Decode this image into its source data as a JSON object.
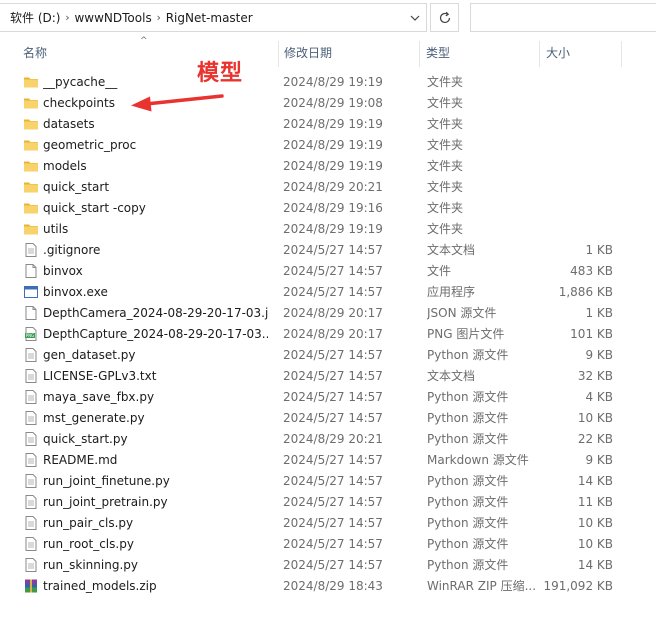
{
  "address": {
    "crumbs": [
      "软件 (D:)",
      "wwwNDTools",
      "RigNet-master"
    ]
  },
  "columns": {
    "name": "名称",
    "date": "修改日期",
    "type": "类型",
    "size": "大小"
  },
  "annotation": {
    "label": "模型",
    "color": "#e8332f"
  },
  "files": [
    {
      "name": "__pycache__",
      "date": "2024/8/29 19:19",
      "type": "文件夹",
      "size": "",
      "icon": "folder-icon"
    },
    {
      "name": "checkpoints",
      "date": "2024/8/29 19:08",
      "type": "文件夹",
      "size": "",
      "icon": "folder-icon"
    },
    {
      "name": "datasets",
      "date": "2024/8/29 19:19",
      "type": "文件夹",
      "size": "",
      "icon": "folder-icon"
    },
    {
      "name": "geometric_proc",
      "date": "2024/8/29 19:19",
      "type": "文件夹",
      "size": "",
      "icon": "folder-icon"
    },
    {
      "name": "models",
      "date": "2024/8/29 19:19",
      "type": "文件夹",
      "size": "",
      "icon": "folder-icon"
    },
    {
      "name": "quick_start",
      "date": "2024/8/29 20:21",
      "type": "文件夹",
      "size": "",
      "icon": "folder-icon"
    },
    {
      "name": "quick_start -copy",
      "date": "2024/8/29 19:16",
      "type": "文件夹",
      "size": "",
      "icon": "folder-icon"
    },
    {
      "name": "utils",
      "date": "2024/8/29 19:19",
      "type": "文件夹",
      "size": "",
      "icon": "folder-icon"
    },
    {
      "name": ".gitignore",
      "date": "2024/5/27 14:57",
      "type": "文本文档",
      "size": "1 KB",
      "icon": "text-file-icon"
    },
    {
      "name": "binvox",
      "date": "2024/5/27 14:57",
      "type": "文件",
      "size": "483 KB",
      "icon": "blank-file-icon"
    },
    {
      "name": "binvox.exe",
      "date": "2024/5/27 14:57",
      "type": "应用程序",
      "size": "1,886 KB",
      "icon": "exe-icon"
    },
    {
      "name": "DepthCamera_2024-08-29-20-17-03.j...",
      "date": "2024/8/29 20:17",
      "type": "JSON 源文件",
      "size": "1 KB",
      "icon": "blank-file-icon"
    },
    {
      "name": "DepthCapture_2024-08-29-20-17-03....",
      "date": "2024/8/29 20:17",
      "type": "PNG 图片文件",
      "size": "101 KB",
      "icon": "png-icon"
    },
    {
      "name": "gen_dataset.py",
      "date": "2024/5/27 14:57",
      "type": "Python 源文件",
      "size": "9 KB",
      "icon": "text-file-icon"
    },
    {
      "name": "LICENSE-GPLv3.txt",
      "date": "2024/5/27 14:57",
      "type": "文本文档",
      "size": "32 KB",
      "icon": "text-file-icon"
    },
    {
      "name": "maya_save_fbx.py",
      "date": "2024/5/27 14:57",
      "type": "Python 源文件",
      "size": "4 KB",
      "icon": "text-file-icon"
    },
    {
      "name": "mst_generate.py",
      "date": "2024/5/27 14:57",
      "type": "Python 源文件",
      "size": "10 KB",
      "icon": "text-file-icon"
    },
    {
      "name": "quick_start.py",
      "date": "2024/8/29 20:21",
      "type": "Python 源文件",
      "size": "22 KB",
      "icon": "text-file-icon"
    },
    {
      "name": "README.md",
      "date": "2024/5/27 14:57",
      "type": "Markdown 源文件",
      "size": "9 KB",
      "icon": "text-file-icon"
    },
    {
      "name": "run_joint_finetune.py",
      "date": "2024/5/27 14:57",
      "type": "Python 源文件",
      "size": "14 KB",
      "icon": "text-file-icon"
    },
    {
      "name": "run_joint_pretrain.py",
      "date": "2024/5/27 14:57",
      "type": "Python 源文件",
      "size": "11 KB",
      "icon": "text-file-icon"
    },
    {
      "name": "run_pair_cls.py",
      "date": "2024/5/27 14:57",
      "type": "Python 源文件",
      "size": "10 KB",
      "icon": "text-file-icon"
    },
    {
      "name": "run_root_cls.py",
      "date": "2024/5/27 14:57",
      "type": "Python 源文件",
      "size": "10 KB",
      "icon": "text-file-icon"
    },
    {
      "name": "run_skinning.py",
      "date": "2024/5/27 14:57",
      "type": "Python 源文件",
      "size": "14 KB",
      "icon": "text-file-icon"
    },
    {
      "name": "trained_models.zip",
      "date": "2024/8/29 18:43",
      "type": "WinRAR ZIP 压缩...",
      "size": "191,092 KB",
      "icon": "winrar-icon"
    }
  ]
}
